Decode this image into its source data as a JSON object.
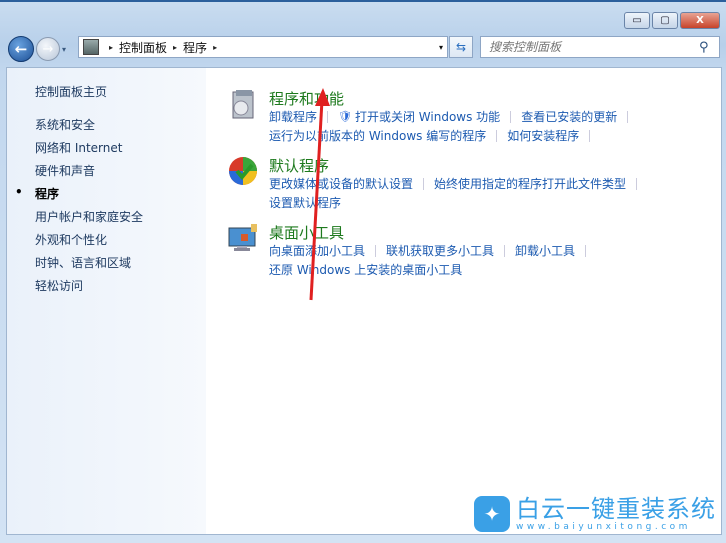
{
  "window": {
    "minimize": "▭",
    "maximize": "▢",
    "close": "X"
  },
  "nav": {
    "back": "←",
    "forward": "→",
    "history": "▾"
  },
  "address": {
    "crumbs": [
      "控制面板",
      "程序"
    ],
    "separator": "▸",
    "dropdown": "▾",
    "refresh": "⇆"
  },
  "search": {
    "placeholder": "搜索控制面板",
    "icon": "search-icon"
  },
  "sidebar": {
    "items": [
      {
        "label": "控制面板主页"
      },
      {
        "label": "系统和安全"
      },
      {
        "label": "网络和 Internet"
      },
      {
        "label": "硬件和声音"
      },
      {
        "label": "程序",
        "current": true
      },
      {
        "label": "用户帐户和家庭安全"
      },
      {
        "label": "外观和个性化"
      },
      {
        "label": "时钟、语言和区域"
      },
      {
        "label": "轻松访问"
      }
    ]
  },
  "categories": [
    {
      "title": "程序和功能",
      "icon": "programs-icon",
      "rows": [
        [
          "卸载程序",
          "打开或关闭 Windows 功能",
          "查看已安装的更新"
        ],
        [
          "运行为以前版本的 Windows 编写的程序",
          "如何安装程序"
        ]
      ]
    },
    {
      "title": "默认程序",
      "icon": "default-programs-icon",
      "rows": [
        [
          "更改媒体或设备的默认设置",
          "始终使用指定的程序打开此文件类型"
        ],
        [
          "设置默认程序"
        ]
      ]
    },
    {
      "title": "桌面小工具",
      "icon": "gadgets-icon",
      "rows": [
        [
          "向桌面添加小工具",
          "联机获取更多小工具",
          "卸载小工具"
        ],
        [
          "还原 Windows 上安装的桌面小工具"
        ]
      ]
    }
  ],
  "colors": {
    "heading": "#1e7a1e",
    "link": "#1c5ab0",
    "annotation_arrow": "#e02020"
  },
  "watermark": {
    "name": "白云一键重装系统",
    "url": "www.baiyunxitong.com"
  }
}
